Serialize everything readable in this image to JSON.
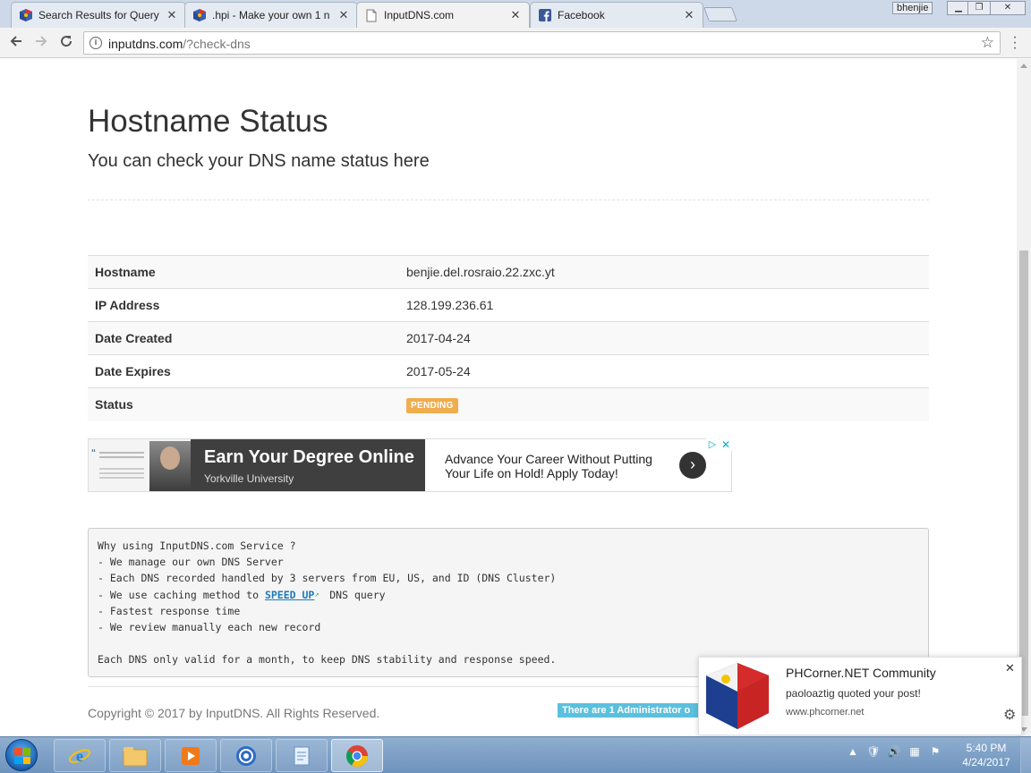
{
  "browser": {
    "tabs": [
      {
        "title": "Search Results for Query",
        "icon": "phcorner-favicon"
      },
      {
        "title": ".hpi - Make your own 1 n",
        "icon": "phcorner-favicon"
      },
      {
        "title": "InputDNS.com",
        "icon": "page-icon",
        "active": true
      },
      {
        "title": "Facebook",
        "icon": "facebook-icon"
      }
    ],
    "close_glyph": "✕",
    "user": "bhenjie",
    "url_host": "inputdns.com",
    "url_path": "/?check-dns"
  },
  "page": {
    "title": "Hostname Status",
    "subtitle": "You can check your DNS name status here",
    "table": [
      {
        "label": "Hostname",
        "value": "benjie.del.rosraio.22.zxc.yt"
      },
      {
        "label": "IP Address",
        "value": "128.199.236.61"
      },
      {
        "label": "Date Created",
        "value": "2017-04-24"
      },
      {
        "label": "Date Expires",
        "value": "2017-05-24"
      },
      {
        "label": "Status",
        "value": "PENDING",
        "badge_color": "#f0ad4e"
      }
    ],
    "ad": {
      "headline": "Earn Your Degree Online",
      "sponsor": "Yorkville University",
      "text": "Advance Your Career Without Putting Your Life on Hold! Apply Today!"
    },
    "why": {
      "heading": "Why using InputDNS.com Service ?",
      "line1": "- We manage our own DNS Server",
      "line2": "- Each DNS recorded handled by 3 servers from EU, US, and ID (DNS Cluster)",
      "line3_pre": "- We use caching method to ",
      "line3_link": "SPEED UP",
      "line3_post": " DNS query",
      "line4": "- Fastest response time",
      "line5": "- We review manually each new record",
      "footer": "Each DNS only valid for a month, to keep DNS stability and response speed."
    },
    "copyright": "Copyright © 2017 by InputDNS. All Rights Reserved.",
    "admin_online": "There are 1 Administrator o"
  },
  "notification": {
    "title": "PHCorner.NET Community",
    "message": "paoloaztig quoted your post!",
    "url": "www.phcorner.net"
  },
  "taskbar": {
    "time": "5:40 PM",
    "date": "4/24/2017"
  }
}
